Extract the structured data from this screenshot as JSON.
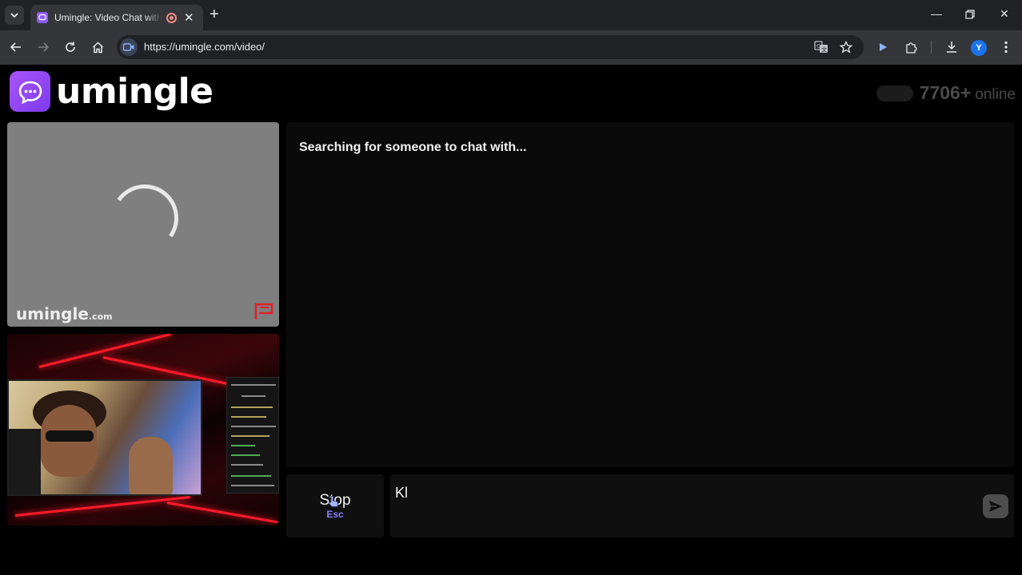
{
  "browser": {
    "tab_title": "Umingle: Video Chat with Strangers",
    "url": "https://umingle.com/video/",
    "profile_initial": "Y"
  },
  "header": {
    "logo_text": "umingle",
    "online_count": "7706+",
    "online_label": "online"
  },
  "stranger_video": {
    "watermark_main": "umingle",
    "watermark_suffix": ".com"
  },
  "chat": {
    "status_message": "Searching for someone to chat with..."
  },
  "controls": {
    "stop_label": "Stop",
    "stop_shortcut": "Esc",
    "message_value": "Kl"
  },
  "colors": {
    "accent": "#8b7cff",
    "logo_gradient_start": "#a855f7",
    "logo_gradient_end": "#7c3aed",
    "report_flag": "#e0202a"
  }
}
